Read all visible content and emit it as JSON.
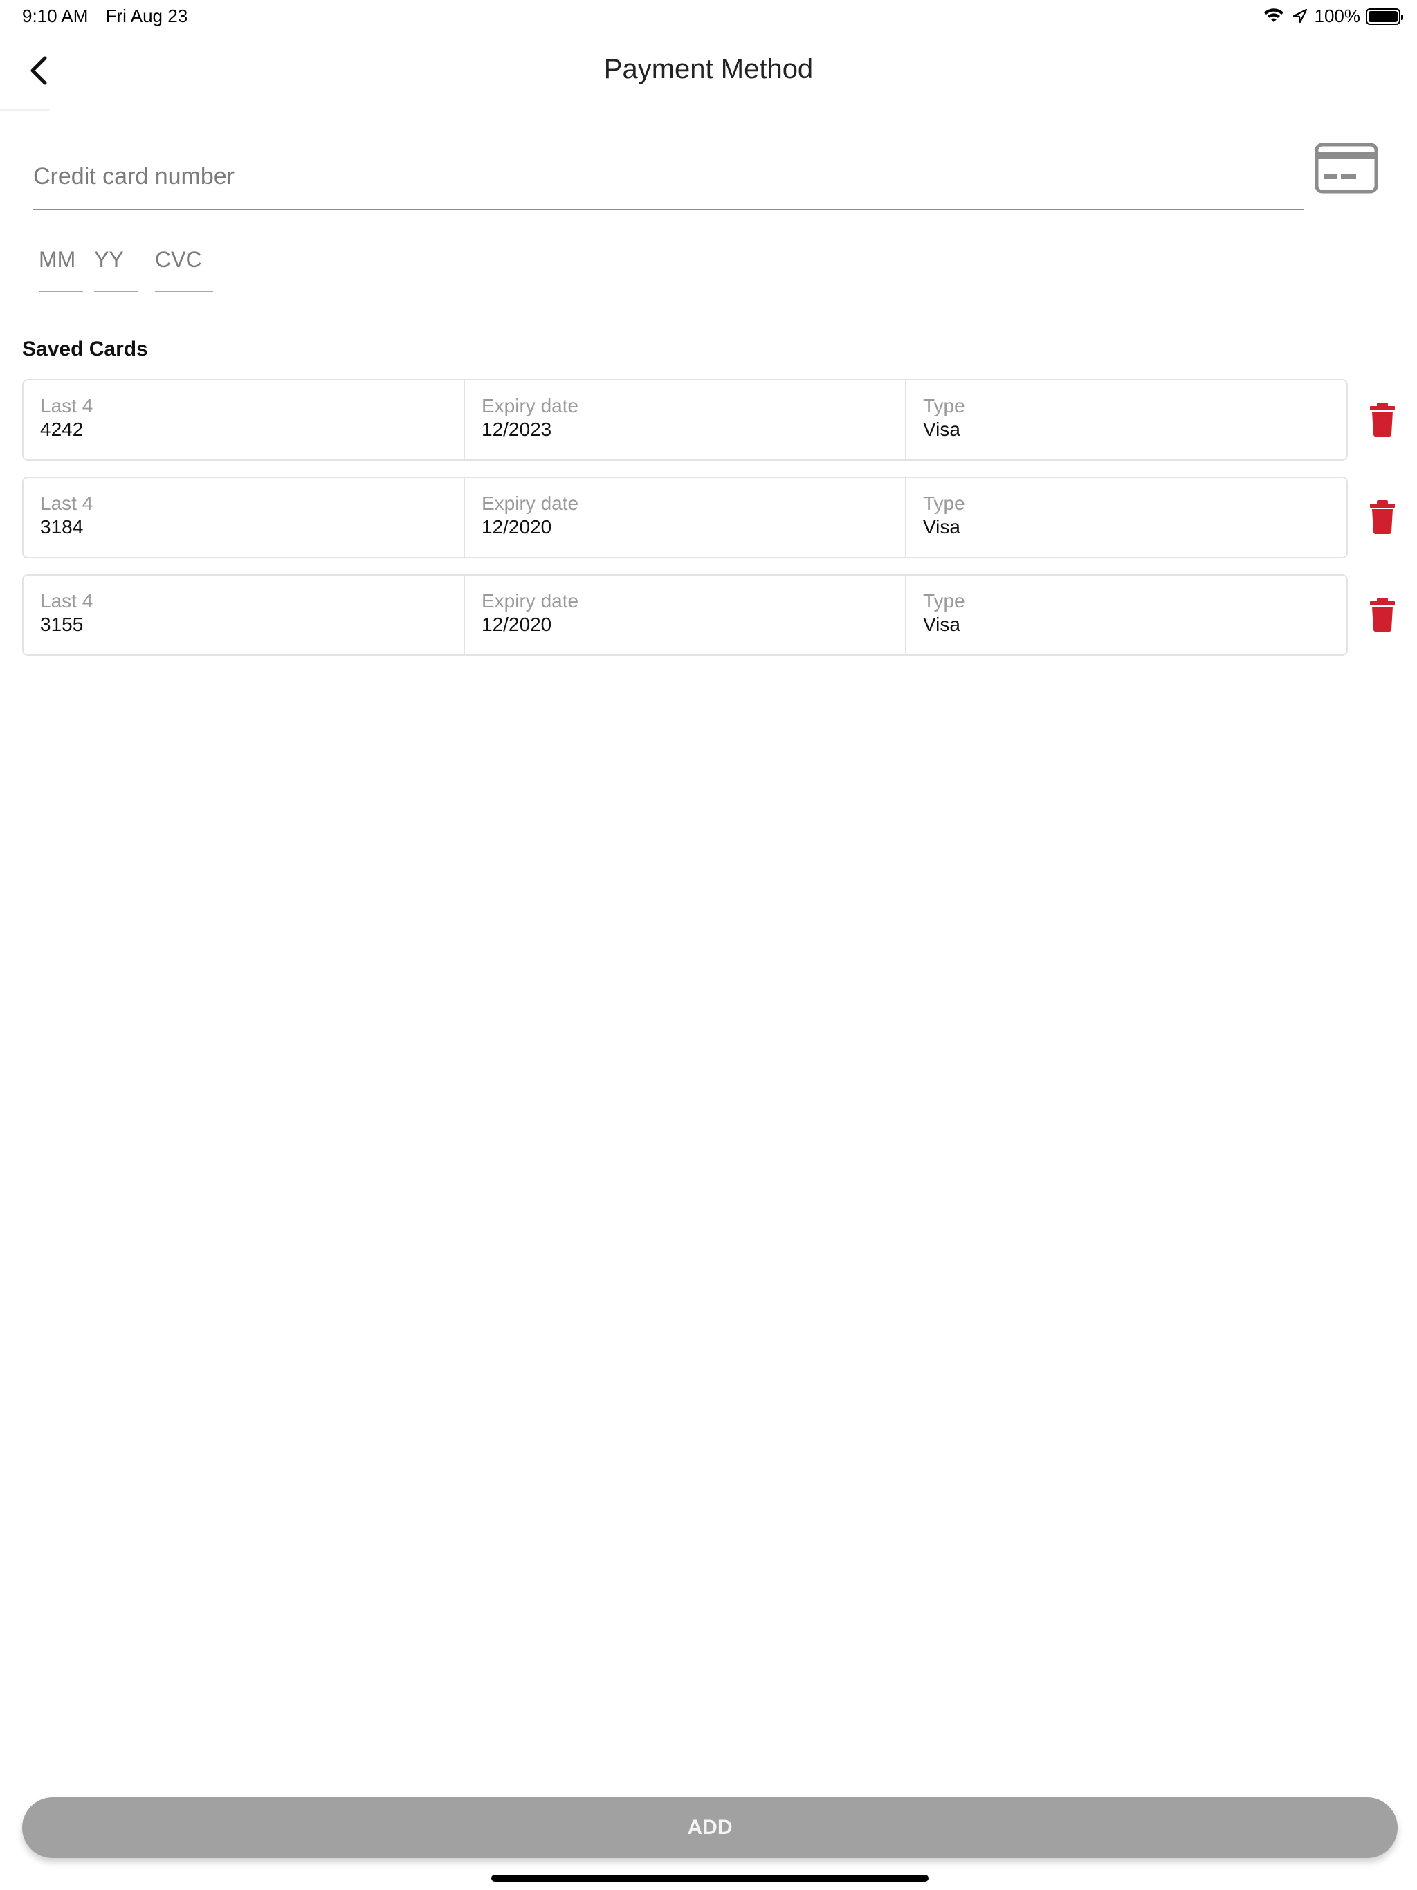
{
  "status_bar": {
    "time": "9:10 AM",
    "date": "Fri Aug 23",
    "battery_percent": "100%",
    "battery_level": 1.0,
    "icons": [
      "wifi-icon",
      "location-arrow-icon",
      "battery-icon"
    ]
  },
  "nav": {
    "title": "Payment Method",
    "back_icon": "chevron-left-icon"
  },
  "form": {
    "card_number_placeholder": "Credit card number",
    "card_icon": "credit-card-icon",
    "month_placeholder": "MM",
    "year_placeholder": "YY",
    "cvc_placeholder": "CVC"
  },
  "saved_cards": {
    "title": "Saved Cards",
    "cards": [
      {
        "last4_label": "Last 4",
        "last4": "4242",
        "expiry_label": "Expiry date",
        "expiry": "12/2023",
        "type_label": "Type",
        "type": "Visa"
      },
      {
        "last4_label": "Last 4",
        "last4": "3184",
        "expiry_label": "Expiry date",
        "expiry": "12/2020",
        "type_label": "Type",
        "type": "Visa"
      },
      {
        "last4_label": "Last 4",
        "last4": "3155",
        "expiry_label": "Expiry date",
        "expiry": "12/2020",
        "type_label": "Type",
        "type": "Visa"
      }
    ],
    "delete_icon": "trash-icon"
  },
  "actions": {
    "add_label": "ADD"
  },
  "colors": {
    "delete_red": "#d0202e",
    "button_gray": "#a1a1a1",
    "border": "#e3e3e3",
    "label_gray": "#9a9a9a"
  }
}
